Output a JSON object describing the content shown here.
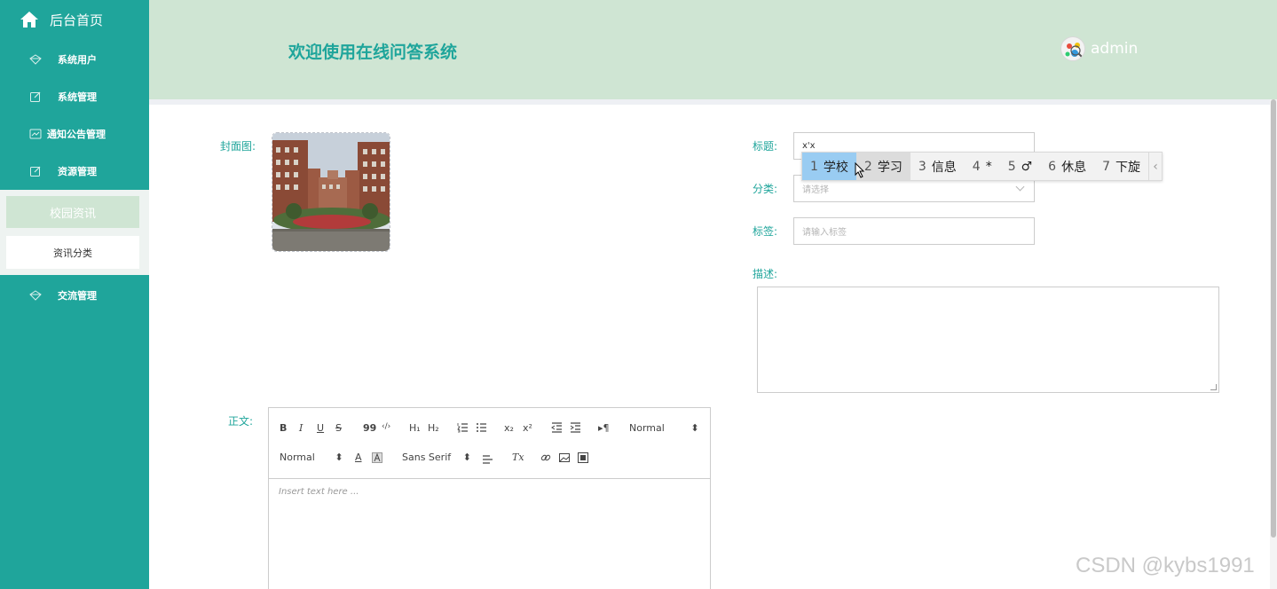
{
  "sidebar": {
    "home_label": "后台首页",
    "items": [
      {
        "label": "系统用户",
        "icon": "diamond-icon"
      },
      {
        "label": "系统管理",
        "icon": "edit-icon"
      },
      {
        "label": "通知公告管理",
        "icon": "chart-icon"
      },
      {
        "label": "资源管理",
        "icon": "edit-icon"
      },
      {
        "label": "交流管理",
        "icon": "diamond-icon"
      }
    ],
    "active_group": "校园资讯",
    "sub_item": "资讯分类"
  },
  "header": {
    "title": "欢迎使用在线问答系统",
    "user": "admin"
  },
  "form": {
    "cover_label": "封面图:",
    "title_label": "标题:",
    "title_value": "x'x",
    "category_label": "分类:",
    "category_placeholder": "请选择",
    "tags_label": "标签:",
    "tags_placeholder": "请输入标签",
    "desc_label": "描述:",
    "body_label": "正文:"
  },
  "ime": {
    "candidates": [
      {
        "num": "1",
        "text": "学校"
      },
      {
        "num": "2",
        "text": "学习"
      },
      {
        "num": "3",
        "text": "信息"
      },
      {
        "num": "4",
        "text": "*"
      },
      {
        "num": "5",
        "text": "♂"
      },
      {
        "num": "6",
        "text": "休息"
      },
      {
        "num": "7",
        "text": "下旋"
      }
    ],
    "prev": "‹"
  },
  "editor": {
    "header_select": "Normal",
    "size_select": "Normal",
    "font_select": "Sans Serif",
    "placeholder": "Insert text here ...",
    "buttons": {
      "bold": "B",
      "italic": "I",
      "underline": "U",
      "strike": "S",
      "quote": "99",
      "code": "‹/›",
      "h1": "H₁",
      "h2": "H₂",
      "sub": "x₂",
      "sup": "x²",
      "rtl": "▸¶",
      "color": "A",
      "clean": "Tx"
    }
  },
  "watermark": "CSDN @kybs1991",
  "colors": {
    "sidebar": "#1fa59b",
    "header": "#cfe5d3",
    "accent": "#1fa59b"
  }
}
